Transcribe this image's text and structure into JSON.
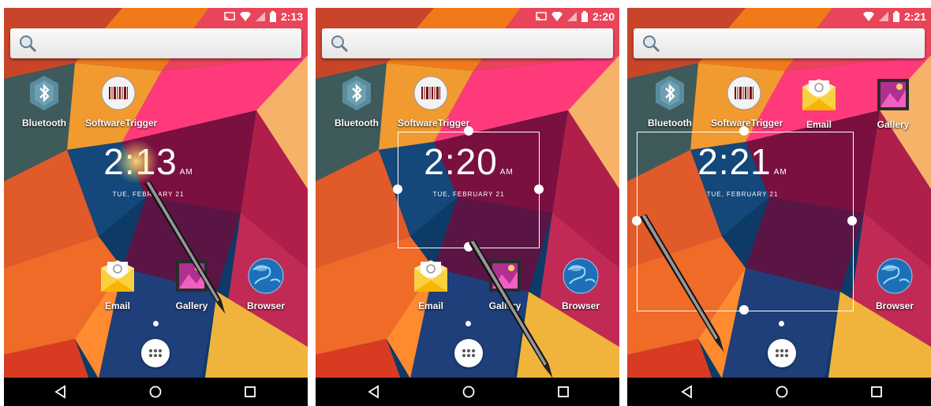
{
  "colors": {
    "accent": "#ffffff",
    "navbar": "#000000"
  },
  "screens": [
    {
      "status_time": "2:13",
      "apps": [
        {
          "label": "Bluetooth",
          "icon": "bluetooth-icon"
        },
        {
          "label": "SoftwareTrigger",
          "icon": "barcode-icon"
        },
        {
          "label": "Email",
          "icon": "email-icon"
        },
        {
          "label": "Gallery",
          "icon": "gallery-icon"
        },
        {
          "label": "Browser",
          "icon": "browser-icon"
        }
      ],
      "clock": {
        "time": "2:13",
        "ampm": "AM",
        "date": "TUE, FEBRUARY 21"
      }
    },
    {
      "status_time": "2:20",
      "apps": [
        {
          "label": "Bluetooth",
          "icon": "bluetooth-icon"
        },
        {
          "label": "SoftwareTrigger",
          "icon": "barcode-icon"
        },
        {
          "label": "Email",
          "icon": "email-icon"
        },
        {
          "label": "Gallery",
          "icon": "gallery-icon"
        },
        {
          "label": "Browser",
          "icon": "browser-icon"
        }
      ],
      "clock": {
        "time": "2:20",
        "ampm": "AM",
        "date": "TUE, FEBRUARY 21"
      }
    },
    {
      "status_time": "2:21",
      "apps": [
        {
          "label": "Bluetooth",
          "icon": "bluetooth-icon"
        },
        {
          "label": "SoftwareTrigger",
          "icon": "barcode-icon"
        },
        {
          "label": "Email",
          "icon": "email-icon"
        },
        {
          "label": "Gallery",
          "icon": "gallery-icon"
        },
        {
          "label": "Browser",
          "icon": "browser-icon"
        }
      ],
      "clock": {
        "time": "2:21",
        "ampm": "AM",
        "date": "TUE, FEBRUARY 21"
      }
    }
  ],
  "navbar": {
    "back": "back-icon",
    "home": "home-icon",
    "recents": "recents-icon"
  }
}
